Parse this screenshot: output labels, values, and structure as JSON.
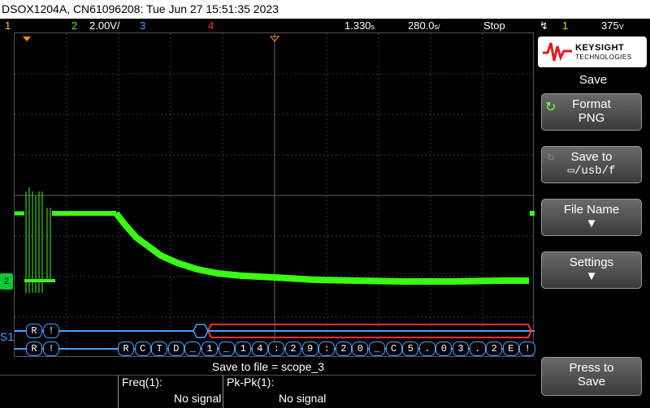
{
  "title": "DSOX1204A, CN61096208: Tue Jun 27 15:51:35 2023",
  "status": {
    "ch1": "1",
    "ch2": "2",
    "ch2_scale": "2.00V/",
    "ch3": "3",
    "ch4": "4",
    "time_ref": "1.330",
    "time_ref_unit": "s",
    "time_scale": "280.0",
    "time_scale_unit": "s/",
    "run_state": "Stop",
    "trig_icon": "trigger-edge-icon",
    "trig_ch": "1",
    "trig_level": "375",
    "trig_level_unit": "V"
  },
  "sidebar": {
    "brand1": "KEYSIGHT",
    "brand2": "TECHNOLOGIES",
    "menu_title": "Save",
    "format_label": "Format",
    "format_value": "PNG",
    "saveto_label": "Save to",
    "saveto_value": "/usb/f",
    "filename_label": "File Name",
    "settings_label": "Settings",
    "press_label": "Press to",
    "press_value": "Save"
  },
  "save_message": "Save to file = scope_3",
  "measurements": [
    {
      "label": "Freq(1):",
      "value": "No signal"
    },
    {
      "label": "Pk-Pk(1):",
      "value": "No signal"
    }
  ],
  "ch2_marker": "2",
  "serial_label": "S1",
  "decode": {
    "row1": [
      "R",
      "!"
    ],
    "row2": [
      "R",
      "!",
      "R",
      "C",
      "T",
      "D",
      "_",
      "1",
      "_",
      "1",
      "4",
      ":",
      "2",
      "9",
      ":",
      "2",
      "0",
      "_",
      "C",
      "5",
      ".",
      "0",
      "3",
      ".",
      "2",
      "E",
      "!"
    ]
  },
  "colors": {
    "trace": "#39ff14",
    "ch1": "#ffd400",
    "ch2": "#39ff14",
    "ch3": "#4aa3ff",
    "ch4": "#ff3030",
    "decode_line": "#4aa3ff",
    "decode_error": "#ff3030"
  }
}
